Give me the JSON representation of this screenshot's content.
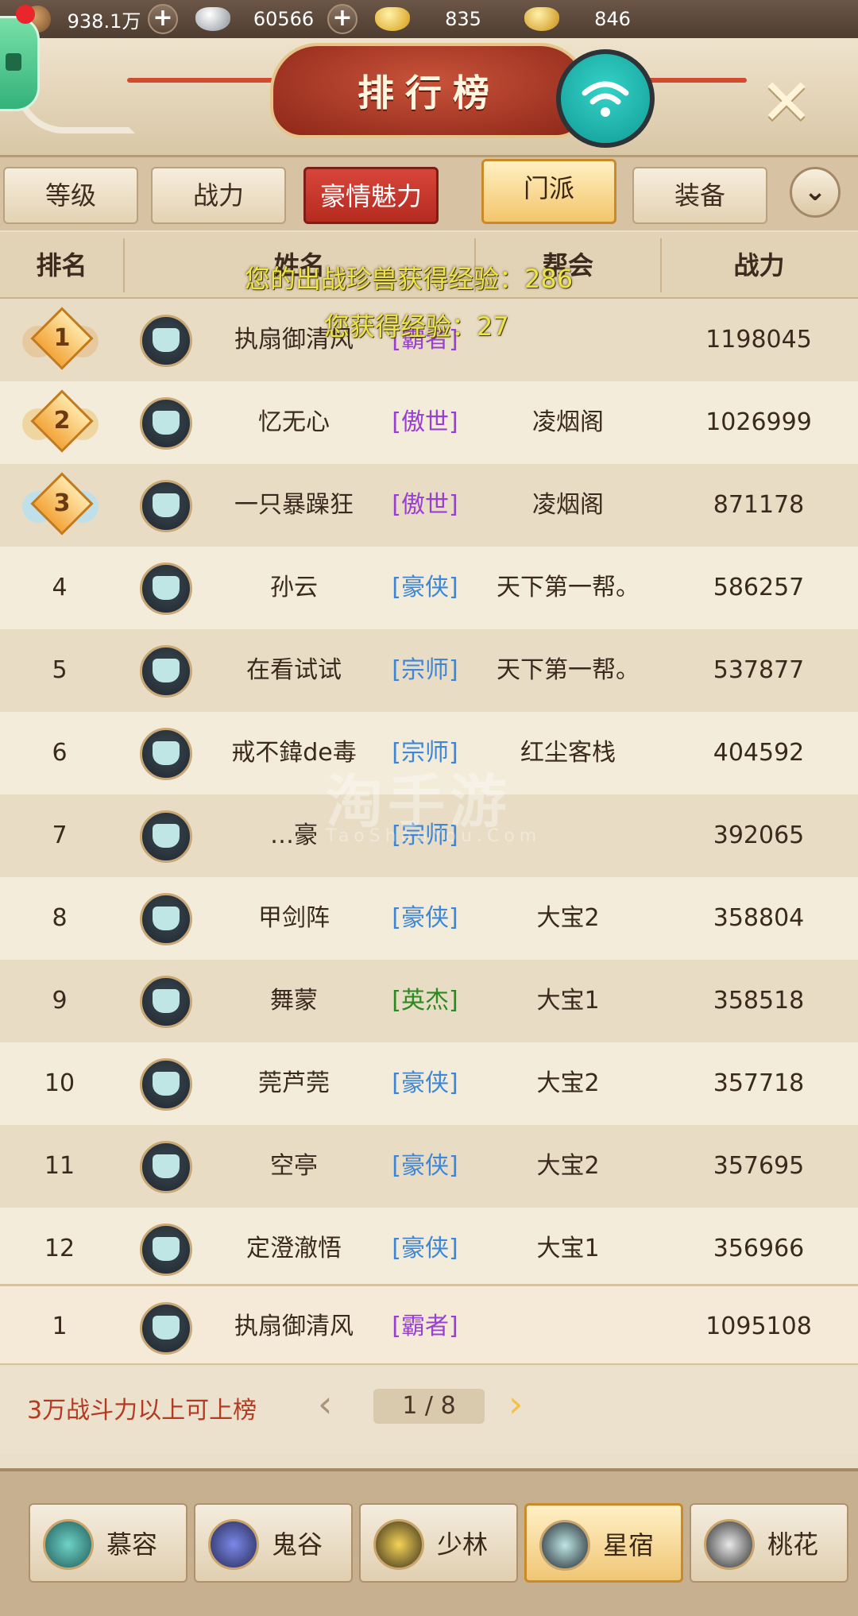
{
  "currencies": [
    {
      "icon": "copper-coin-icon",
      "value": "938.1万",
      "has_plus": true
    },
    {
      "icon": "silver-ingot-icon",
      "value": "60566",
      "has_plus": true
    },
    {
      "icon": "gold-ingot-icon",
      "value": "835",
      "has_plus": false
    },
    {
      "icon": "locked-gold-ingot-icon",
      "value": "846",
      "has_plus": false
    }
  ],
  "header": {
    "title": "排行榜",
    "close_icon": "close-icon",
    "wifi_icon": "wifi-icon"
  },
  "tabs": [
    "等级",
    "战力",
    "豪情魅力",
    "门派",
    "装备"
  ],
  "active_tab": "门派",
  "table_headers": {
    "rank": "排名",
    "name": "姓名",
    "guild": "帮会",
    "power": "战力"
  },
  "overlay": {
    "line1": "您的出战珍兽获得经验：286",
    "line2": "您获得经验：27"
  },
  "rows": [
    {
      "rank": "1",
      "name": "执扇御清风",
      "title": "[霸者]",
      "guild": "",
      "power": "1198045"
    },
    {
      "rank": "2",
      "name": "忆无心",
      "title": "[傲世]",
      "guild": "凌烟阁",
      "power": "1026999"
    },
    {
      "rank": "3",
      "name": "一只暴躁狂",
      "title": "[傲世]",
      "guild": "凌烟阁",
      "power": "871178"
    },
    {
      "rank": "4",
      "name": "孙云",
      "title": "[豪侠]",
      "guild": "天下第一帮。",
      "power": "586257"
    },
    {
      "rank": "5",
      "name": "在看试试",
      "title": "[宗师]",
      "guild": "天下第一帮。",
      "power": "537877"
    },
    {
      "rank": "6",
      "name": "戒不鍏de毒",
      "title": "[宗师]",
      "guild": "红尘客栈",
      "power": "404592"
    },
    {
      "rank": "7",
      "name": "…豪",
      "title": "[宗师]",
      "guild": "",
      "power": "392065"
    },
    {
      "rank": "8",
      "name": "甲剑阵",
      "title": "[豪侠]",
      "guild": "大宝2",
      "power": "358804"
    },
    {
      "rank": "9",
      "name": "舞蒙",
      "title": "[英杰]",
      "guild": "大宝1",
      "power": "358518"
    },
    {
      "rank": "10",
      "name": "莞芦莞",
      "title": "[豪侠]",
      "guild": "大宝2",
      "power": "357718"
    },
    {
      "rank": "11",
      "name": "空亭",
      "title": "[豪侠]",
      "guild": "大宝2",
      "power": "357695"
    },
    {
      "rank": "12",
      "name": "定澄澈悟",
      "title": "[豪侠]",
      "guild": "大宝1",
      "power": "356966"
    }
  ],
  "my_row": {
    "rank": "1",
    "name": "执扇御清风",
    "title": "[霸者]",
    "guild": "",
    "power": "1095108"
  },
  "footer": {
    "tip": "3万战斗力以上可上榜",
    "page": "1 / 8"
  },
  "sects": [
    "慕容",
    "鬼谷",
    "少林",
    "星宿",
    "桃花"
  ],
  "active_sect": "星宿",
  "watermark": {
    "main": "淘手游",
    "sub": "TaoShouYou.Com"
  },
  "colors": {
    "title_purple": "#9a3fd4",
    "title_blue": "#3d86d8",
    "title_green": "#2c8a22",
    "tip_red": "#b43a22",
    "overlay_yellow": "#ece54a"
  }
}
